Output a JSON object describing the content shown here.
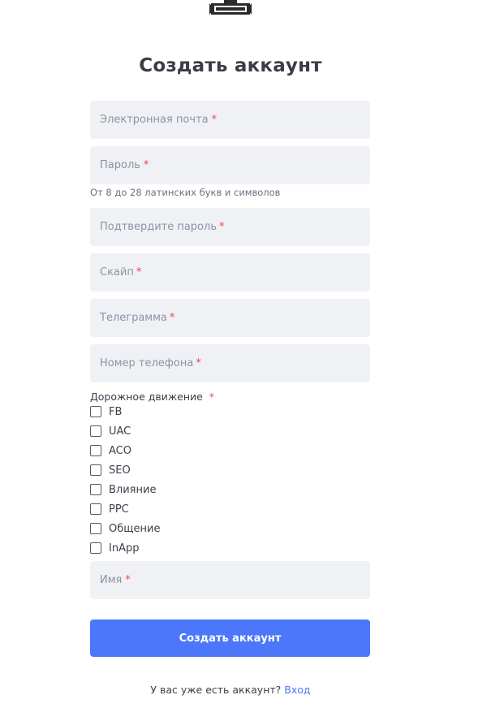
{
  "header": {
    "title": "Создать аккаунт"
  },
  "fields": {
    "email": {
      "placeholder": "Электронная почта",
      "required": "*"
    },
    "password": {
      "placeholder": "Пароль",
      "required": "*"
    },
    "password_hint": "От 8 до 28 латинских букв и символов",
    "confirm": {
      "placeholder": "Подтвердите пароль",
      "required": "*"
    },
    "skype": {
      "placeholder": "Скайп",
      "required": "*"
    },
    "telegram": {
      "placeholder": "Телеграмма",
      "required": "*"
    },
    "phone": {
      "placeholder": "Номер телефона",
      "required": "*"
    },
    "name": {
      "placeholder": "Имя",
      "required": "*"
    }
  },
  "traffic": {
    "label": "Дорожное движение",
    "required": "*",
    "options": [
      {
        "label": "FB",
        "checked": false
      },
      {
        "label": "UAC",
        "checked": false
      },
      {
        "label": "ACO",
        "checked": false
      },
      {
        "label": "SEO",
        "checked": false
      },
      {
        "label": "Влияние",
        "checked": false
      },
      {
        "label": "PPC",
        "checked": false
      },
      {
        "label": "Общение",
        "checked": false
      },
      {
        "label": "InApp",
        "checked": false
      }
    ]
  },
  "submit_label": "Создать аккаунт",
  "footer": {
    "text": "У вас уже есть аккаунт?",
    "link": "Вход"
  },
  "colors": {
    "accent": "#4d77fa",
    "field_bg": "#f0f1f5",
    "required": "#e5484d"
  }
}
